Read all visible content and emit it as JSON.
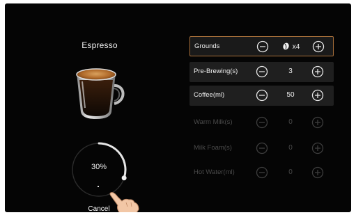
{
  "drink": {
    "name": "Espresso"
  },
  "progress": {
    "percent_label": "30%",
    "value": 0.3
  },
  "cancel_label": "Cancel",
  "settings": [
    {
      "label": "Grounds",
      "value": "x4",
      "state": "selected"
    },
    {
      "label": "Pre-Brewing(s)",
      "value": "3",
      "state": "active"
    },
    {
      "label": "Coffee(ml)",
      "value": "50",
      "state": "active"
    },
    {
      "label": "Warm Milk(s)",
      "value": "0",
      "state": "disabled"
    },
    {
      "label": "Milk Foam(s)",
      "value": "0",
      "state": "disabled"
    },
    {
      "label": "Hot Water(ml)",
      "value": "0",
      "state": "disabled"
    }
  ],
  "icons": {
    "minus": "minus-circle-icon",
    "plus": "plus-circle-icon",
    "bean": "coffee-bean-icon",
    "cup": "espresso-cup-icon",
    "hand": "pointing-hand-icon"
  },
  "colors": {
    "background": "#050505",
    "selected_border": "#a9703a",
    "active_row": "#1f1f1f",
    "enabled_text": "#efefef",
    "disabled_text": "#4a4a4a"
  }
}
